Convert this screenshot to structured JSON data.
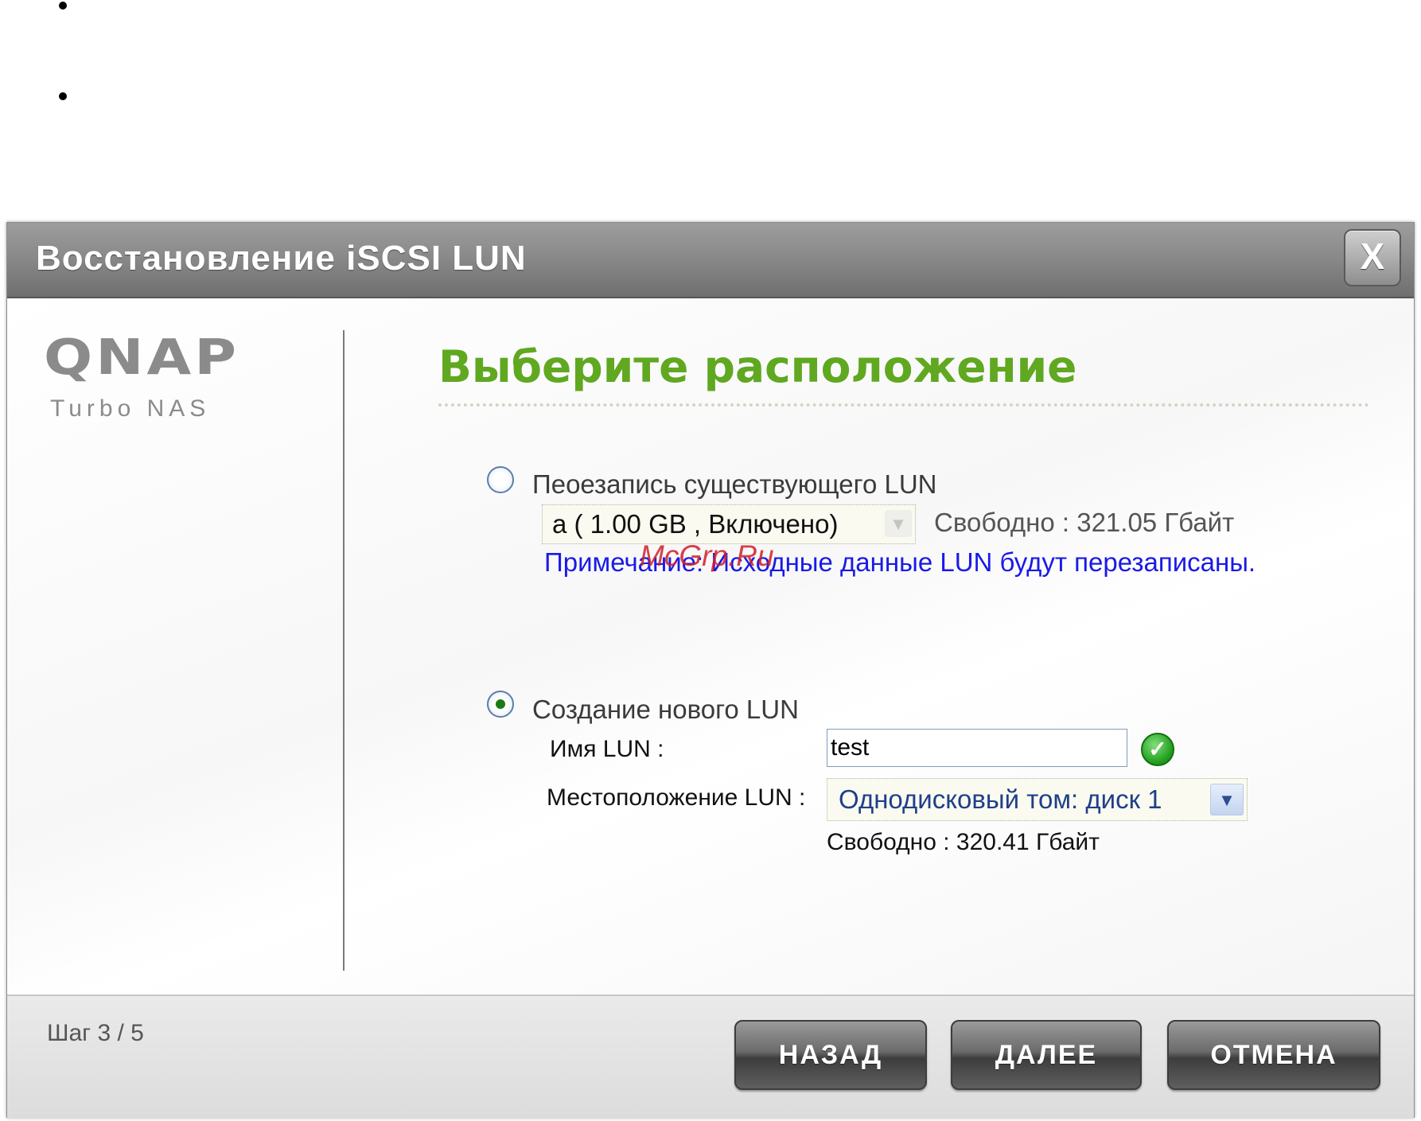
{
  "dialog": {
    "title": "Восстановление iSCSI LUN",
    "close_label": "X"
  },
  "logo": {
    "main": "QNAP",
    "sub": "Turbo NAS"
  },
  "main": {
    "heading": "Выберите расположение",
    "option_overwrite": {
      "label": "Пеоезапись существующего LUN",
      "selected": false,
      "select_value": "a ( 1.00 GB , Включено)",
      "free": "Свободно : 321.05 Гбайт",
      "note": "Примечание: Исходные данные LUN будут перезаписаны."
    },
    "option_create": {
      "label": "Создание нового LUN",
      "selected": true,
      "name_label": "Имя LUN :",
      "name_value": "test",
      "location_label": "Местоположение LUN :",
      "location_value": "Однодисковый том: диск 1",
      "free": "Свободно : 320.41 Гбайт"
    }
  },
  "watermark": "McGrp.Ru",
  "footer": {
    "step": "Шаг 3 / 5",
    "back": "НАЗАД",
    "next": "ДАЛЕЕ",
    "cancel": "ОТМЕНА"
  },
  "colors": {
    "heading": "#5fa820",
    "note": "#1a1ae6",
    "watermark": "#d0202a"
  }
}
